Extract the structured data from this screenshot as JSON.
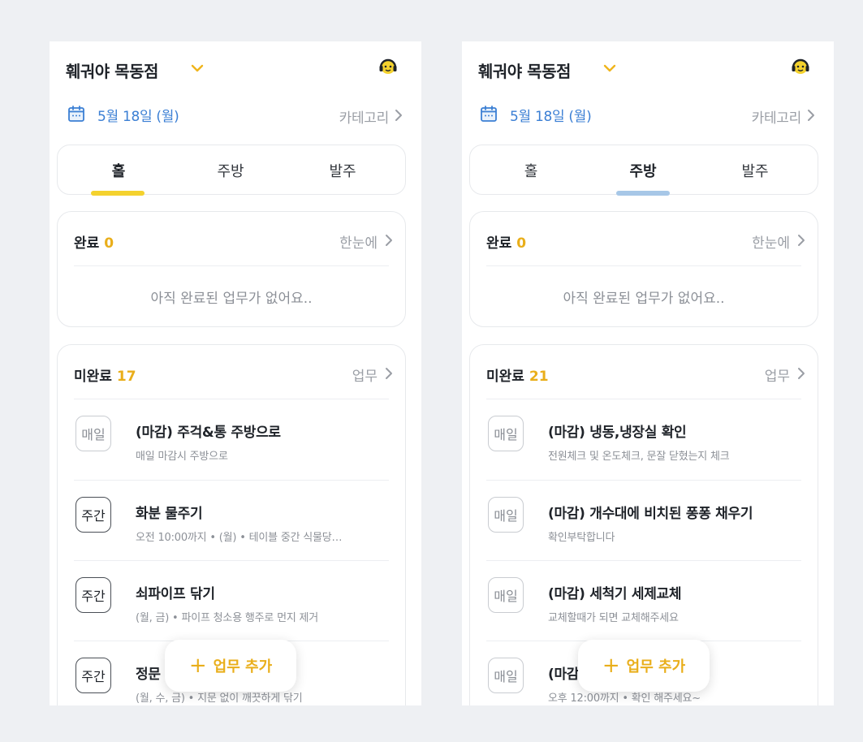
{
  "colors": {
    "accent_yellow": "#f4d22e",
    "accent_blue": "#a7c7e7",
    "count_orange": "#e9ae1a",
    "date_blue": "#3b7fd4"
  },
  "screens": [
    {
      "store_name": "훼궈야 목동점",
      "date": "5월 18일 (월)",
      "category_link": "카테고리",
      "tabs": [
        "홀",
        "주방",
        "발주"
      ],
      "active_tab": 0,
      "done": {
        "label": "완료",
        "count": "0",
        "link": "한눈에",
        "empty": "아직 완료된 업무가 없어요.."
      },
      "todo": {
        "label": "미완료",
        "count": "17",
        "link": "업무",
        "items": [
          {
            "badge": "매일",
            "kind": "daily",
            "title": "(마감) 주걱&통 주방으로",
            "sub": "매일 마감시 주방으로"
          },
          {
            "badge": "주간",
            "kind": "weekly",
            "title": "화분 물주기",
            "sub": "오전 10:00까지 • (월) • 테이블 중간 식물당…"
          },
          {
            "badge": "주간",
            "kind": "weekly",
            "title": "쇠파이프 닦기",
            "sub": "(월, 금) • 파이프 청소용 행주로 먼지 제거"
          },
          {
            "badge": "주간",
            "kind": "weekly",
            "title": "정문",
            "sub": "(월, 수, 금) • 지문 없이 깨끗하게 닦기"
          }
        ]
      },
      "fab": "업무 추가"
    },
    {
      "store_name": "훼궈야 목동점",
      "date": "5월 18일 (월)",
      "category_link": "카테고리",
      "tabs": [
        "홀",
        "주방",
        "발주"
      ],
      "active_tab": 1,
      "done": {
        "label": "완료",
        "count": "0",
        "link": "한눈에",
        "empty": "아직 완료된 업무가 없어요.."
      },
      "todo": {
        "label": "미완료",
        "count": "21",
        "link": "업무",
        "items": [
          {
            "badge": "매일",
            "kind": "daily",
            "title": "(마감) 냉동,냉장실 확인",
            "sub": "전원체크 및 온도체크, 문잘 닫혔는지 체크"
          },
          {
            "badge": "매일",
            "kind": "daily",
            "title": "(마감) 개수대에 비치된 퐁퐁 채우기",
            "sub": "확인부탁합니다"
          },
          {
            "badge": "매일",
            "kind": "daily",
            "title": "(마감) 세척기 세제교체",
            "sub": "교체할때가 되면 교체해주세요"
          },
          {
            "badge": "매일",
            "kind": "daily",
            "title": "(마감",
            "sub": "오후 12:00까지 • 확인 해주세요~"
          }
        ]
      },
      "fab": "업무 추가"
    }
  ]
}
